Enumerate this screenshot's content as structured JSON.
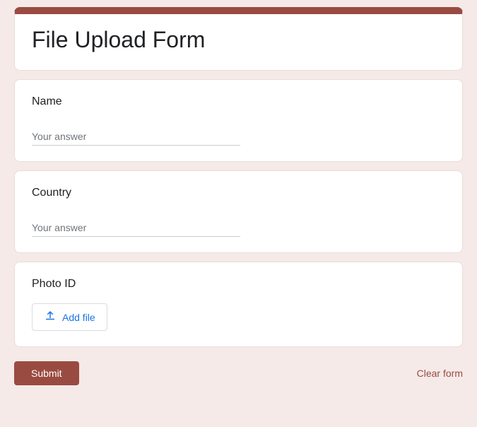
{
  "form": {
    "title": "File Upload Form"
  },
  "questions": {
    "name": {
      "label": "Name",
      "placeholder": "Your answer"
    },
    "country": {
      "label": "Country",
      "placeholder": "Your answer"
    },
    "photo_id": {
      "label": "Photo ID",
      "button": "Add file"
    }
  },
  "actions": {
    "submit": "Submit",
    "clear": "Clear form"
  }
}
